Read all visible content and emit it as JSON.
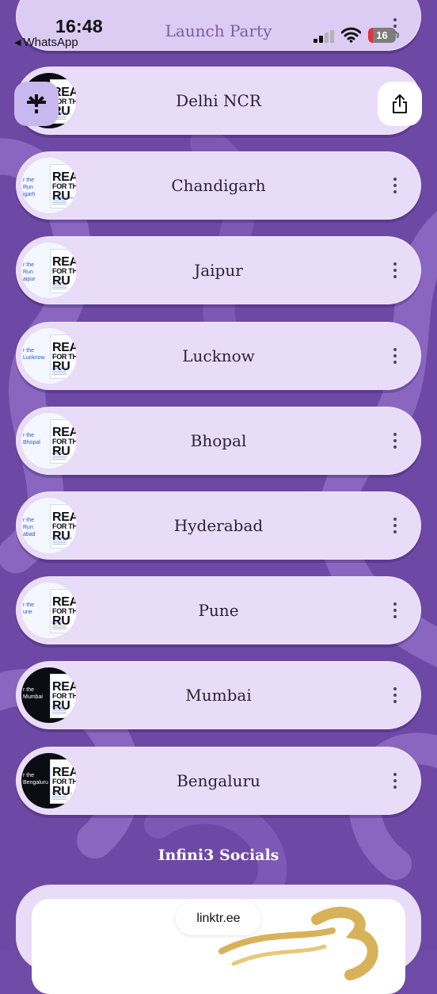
{
  "status_bar": {
    "time": "16:48",
    "back_app": "WhatsApp",
    "battery": "16",
    "battery_level": 0.16
  },
  "top_link": {
    "label": "Launch Party"
  },
  "links": [
    {
      "label": "Delhi NCR",
      "thumb_text": "",
      "city": "DELHI NCR",
      "dark": true
    },
    {
      "label": "Chandigarh",
      "thumb_text": "r the Run igarh",
      "city": "CHANDIGARH",
      "dark": false
    },
    {
      "label": "Jaipur",
      "thumb_text": "r the Run aipur",
      "city": "JAIPUR",
      "dark": false
    },
    {
      "label": "Lucknow",
      "thumb_text": "r the Lucknow",
      "city": "LUCKNOW",
      "dark": false
    },
    {
      "label": "Bhopal",
      "thumb_text": "r the Bhopal",
      "city": "BHOPAL",
      "dark": false
    },
    {
      "label": "Hyderabad",
      "thumb_text": "r the Run abad",
      "city": "HYDERABAD",
      "dark": false
    },
    {
      "label": "Pune",
      "thumb_text": "r the une",
      "city": "PUNE",
      "dark": false
    },
    {
      "label": "Mumbai",
      "thumb_text": "r the Mumbai",
      "city": "MUMBAI",
      "dark": true
    },
    {
      "label": "Bengaluru",
      "thumb_text": "r the Bengaluru",
      "city": "BENGALURU",
      "dark": true
    }
  ],
  "poster": {
    "line1": "REAL",
    "line2": "FOR TH",
    "line3": "RU"
  },
  "socials": {
    "heading": "Infini3 Socials",
    "url": "linktr.ee"
  },
  "colors": {
    "background": "#6f4aa6",
    "card": "#e9dcf8",
    "text": "#2b2236"
  },
  "icons": {
    "linktree": "linktree-asterisk-icon",
    "share": "share-icon",
    "more": "kebab-icon"
  }
}
